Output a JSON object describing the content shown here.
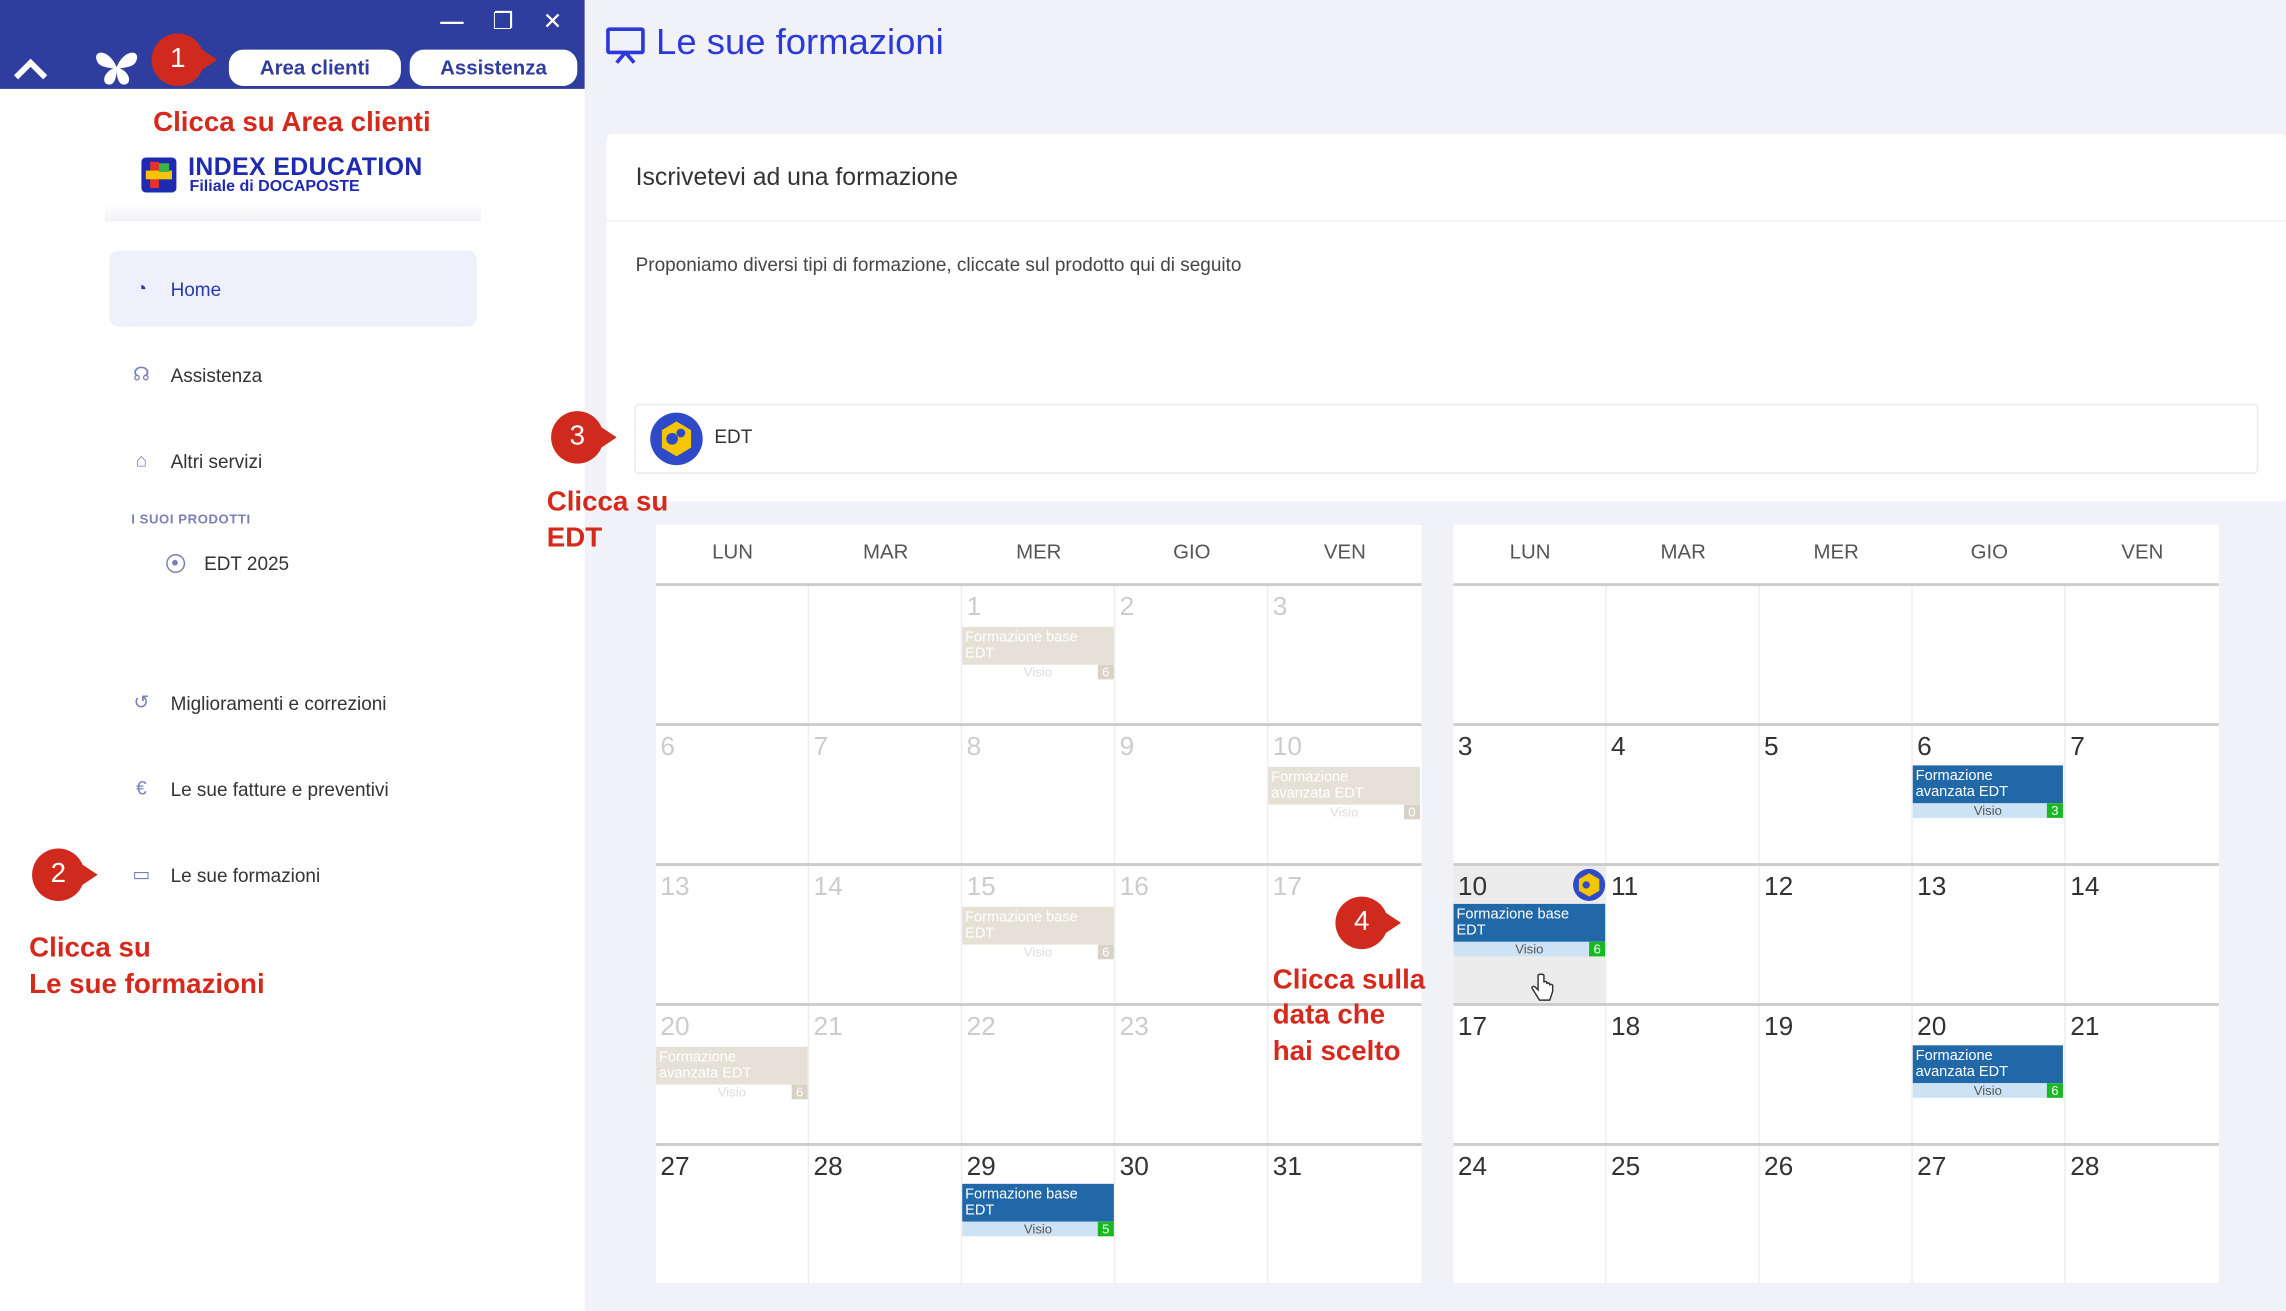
{
  "window": {
    "minimize_glyph": "—",
    "restore_glyph": "❐",
    "close_glyph": "✕"
  },
  "topbar": {
    "area_clienti": "Area clienti",
    "assistenza": "Assistenza"
  },
  "annotations": {
    "badge1": "1",
    "badge2": "2",
    "badge3": "3",
    "badge4": "4",
    "step1": "Clicca su Area clienti",
    "step2_l1": "Clicca su",
    "step2_l2": "Le sue formazioni",
    "step3_l1": "Clicca su",
    "step3_l2": "EDT",
    "step4_l1": "Clicca sulla",
    "step4_l2": "data che",
    "step4_l3": "hai scelto"
  },
  "logo": {
    "name": "INDEX EDUCATION",
    "sub": "Filiale di DOCAPOSTE"
  },
  "sidebar": {
    "items": [
      {
        "label": "Home",
        "icon": "dashboard-icon"
      },
      {
        "label": "Assistenza",
        "icon": "headset-icon"
      },
      {
        "label": "Altri servizi",
        "icon": "bell-icon"
      },
      {
        "label": "Miglioramenti e correzioni",
        "icon": "history-icon"
      },
      {
        "label": "Le sue fatture e preventivi",
        "icon": "euro-icon"
      },
      {
        "label": "Le sue formazioni",
        "icon": "presentation-icon"
      }
    ],
    "products_heading": "I SUOI PRODOTTI",
    "product": "EDT 2025"
  },
  "main": {
    "title": "Le sue formazioni",
    "card_title": "Iscrivetevi ad una formazione",
    "card_desc": "Proponiamo diversi tipi di formazione, cliccate sul prodotto qui di seguito",
    "product_label": "EDT"
  },
  "calendar": {
    "day_headers": [
      "LUN",
      "MAR",
      "MER",
      "GIO",
      "VEN"
    ],
    "left_weeks": [
      [
        "",
        "",
        "1",
        "2",
        "3"
      ],
      [
        "6",
        "7",
        "8",
        "9",
        "10"
      ],
      [
        "13",
        "14",
        "15",
        "16",
        "17"
      ],
      [
        "20",
        "21",
        "22",
        "23",
        ""
      ],
      [
        "27",
        "28",
        "29",
        "30",
        "31"
      ]
    ],
    "right_weeks": [
      [
        "",
        "",
        "",
        "",
        ""
      ],
      [
        "3",
        "4",
        "5",
        "6",
        "7"
      ],
      [
        "10",
        "11",
        "12",
        "13",
        "14"
      ],
      [
        "17",
        "18",
        "19",
        "20",
        "21"
      ],
      [
        "24",
        "25",
        "26",
        "27",
        "28"
      ]
    ],
    "events": {
      "base_l1": "Formazione base",
      "base_l2": "EDT",
      "adv_l1": "Formazione",
      "adv_l2": "avanzata EDT",
      "mode": "Visio",
      "count_l1": "6",
      "count_l10": "0",
      "count_l15": "6",
      "count_l20": "6",
      "count_l29": "5",
      "count_r6": "3",
      "count_r10": "6",
      "count_r20": "6"
    }
  },
  "colors": {
    "brand": "#2f3d9e",
    "annotation": "#d5291c",
    "event_blue": "#2068a8",
    "count_green": "#18b820"
  }
}
